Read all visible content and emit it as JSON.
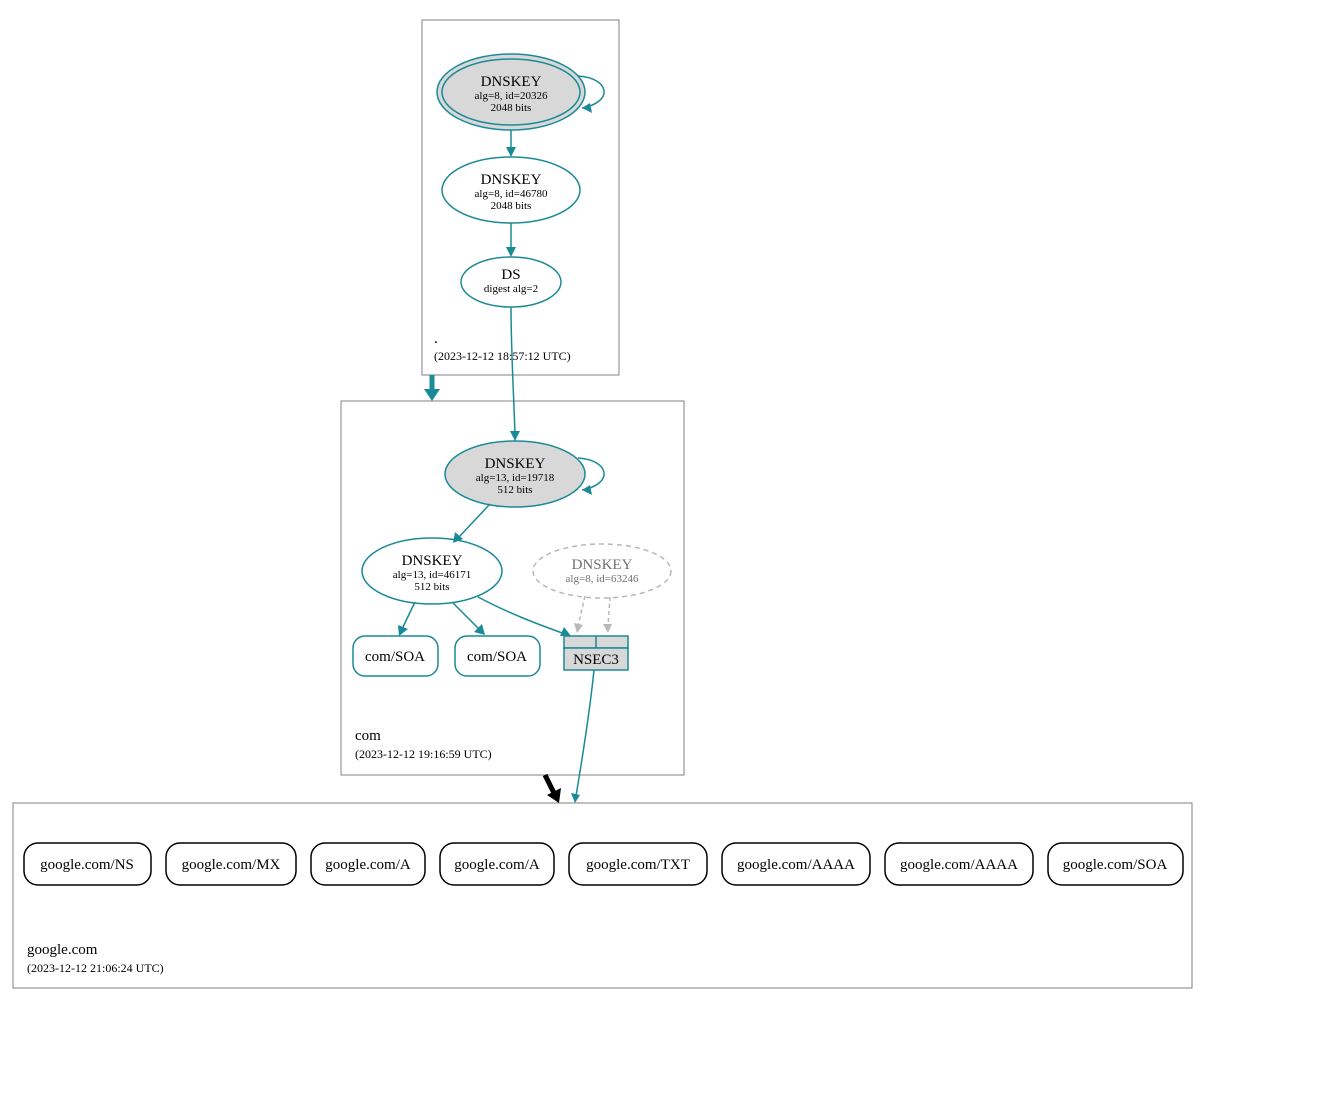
{
  "colors": {
    "teal": "#1a8a97",
    "gray_fill": "#d8d8d8",
    "dashed_stroke": "#b8b8b8"
  },
  "zones": {
    "root": {
      "label": ".",
      "timestamp": "(2023-12-12 18:57:12 UTC)"
    },
    "com": {
      "label": "com",
      "timestamp": "(2023-12-12 19:16:59 UTC)"
    },
    "google": {
      "label": "google.com",
      "timestamp": "(2023-12-12 21:06:24 UTC)"
    }
  },
  "nodes": {
    "root_ksk": {
      "title": "DNSKEY",
      "line1": "alg=8, id=20326",
      "line2": "2048 bits"
    },
    "root_zsk": {
      "title": "DNSKEY",
      "line1": "alg=8, id=46780",
      "line2": "2048 bits"
    },
    "root_ds": {
      "title": "DS",
      "line1": "digest alg=2"
    },
    "com_ksk": {
      "title": "DNSKEY",
      "line1": "alg=13, id=19718",
      "line2": "512 bits"
    },
    "com_zsk": {
      "title": "DNSKEY",
      "line1": "alg=13, id=46171",
      "line2": "512 bits"
    },
    "com_old": {
      "title": "DNSKEY",
      "line1": "alg=8, id=63246"
    },
    "com_soa1": {
      "title": "com/SOA"
    },
    "com_soa2": {
      "title": "com/SOA"
    },
    "nsec3": {
      "title": "NSEC3"
    },
    "g_ns": {
      "title": "google.com/NS"
    },
    "g_mx": {
      "title": "google.com/MX"
    },
    "g_a1": {
      "title": "google.com/A"
    },
    "g_a2": {
      "title": "google.com/A"
    },
    "g_txt": {
      "title": "google.com/TXT"
    },
    "g_aaaa1": {
      "title": "google.com/AAAA"
    },
    "g_aaaa2": {
      "title": "google.com/AAAA"
    },
    "g_soa": {
      "title": "google.com/SOA"
    }
  }
}
